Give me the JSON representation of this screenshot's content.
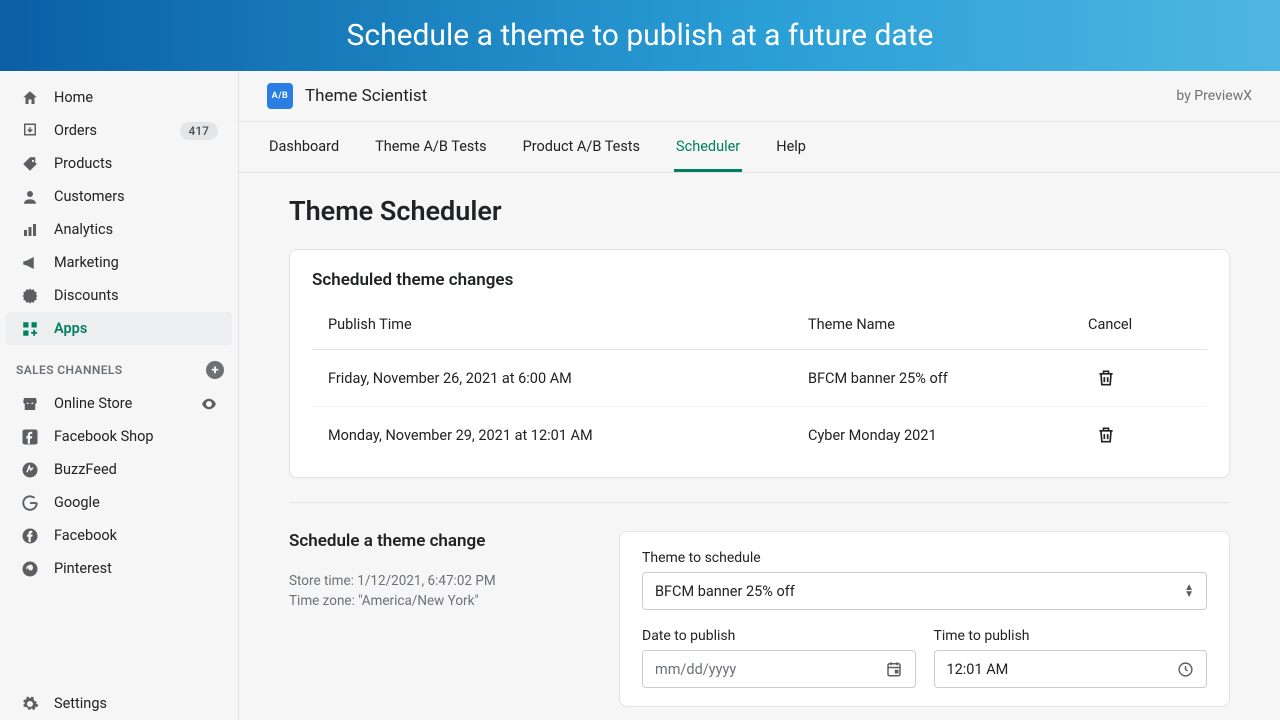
{
  "banner": {
    "text": "Schedule a theme to publish at a future date"
  },
  "sidebar": {
    "items": [
      {
        "label": "Home",
        "icon": "home"
      },
      {
        "label": "Orders",
        "icon": "orders",
        "badge": "417"
      },
      {
        "label": "Products",
        "icon": "tag"
      },
      {
        "label": "Customers",
        "icon": "user"
      },
      {
        "label": "Analytics",
        "icon": "bars"
      },
      {
        "label": "Marketing",
        "icon": "megaphone"
      },
      {
        "label": "Discounts",
        "icon": "discount"
      },
      {
        "label": "Apps",
        "icon": "apps",
        "active": true
      }
    ],
    "channels_label": "SALES CHANNELS",
    "channels": [
      {
        "label": "Online Store",
        "icon": "store",
        "eye": true
      },
      {
        "label": "Facebook Shop",
        "icon": "fb-square"
      },
      {
        "label": "BuzzFeed",
        "icon": "buzz"
      },
      {
        "label": "Google",
        "icon": "google"
      },
      {
        "label": "Facebook",
        "icon": "fb-circle"
      },
      {
        "label": "Pinterest",
        "icon": "pinterest"
      }
    ],
    "settings_label": "Settings"
  },
  "app": {
    "name": "Theme Scientist",
    "by": "by PreviewX",
    "logo_text": "A/B"
  },
  "tabs": [
    {
      "label": "Dashboard"
    },
    {
      "label": "Theme A/B Tests"
    },
    {
      "label": "Product A/B Tests"
    },
    {
      "label": "Scheduler",
      "active": true
    },
    {
      "label": "Help"
    }
  ],
  "page": {
    "title": "Theme Scheduler",
    "card1_title": "Scheduled theme changes",
    "headers": {
      "time": "Publish Time",
      "theme": "Theme Name",
      "cancel": "Cancel"
    },
    "rows": [
      {
        "time": "Friday, November 26, 2021 at 6:00 AM",
        "theme": "BFCM banner 25% off"
      },
      {
        "time": "Monday, November 29, 2021 at 12:01 AM",
        "theme": "Cyber Monday 2021"
      }
    ],
    "section2_title": "Schedule a theme change",
    "store_time": "Store time: 1/12/2021, 6:47:02 PM",
    "time_zone": "Time zone: \"America/New York\"",
    "form": {
      "theme_label": "Theme to schedule",
      "theme_value": "BFCM banner 25% off",
      "date_label": "Date to publish",
      "date_placeholder": "mm/dd/yyyy",
      "time_label": "Time to publish",
      "time_value": "12:01 AM"
    }
  }
}
